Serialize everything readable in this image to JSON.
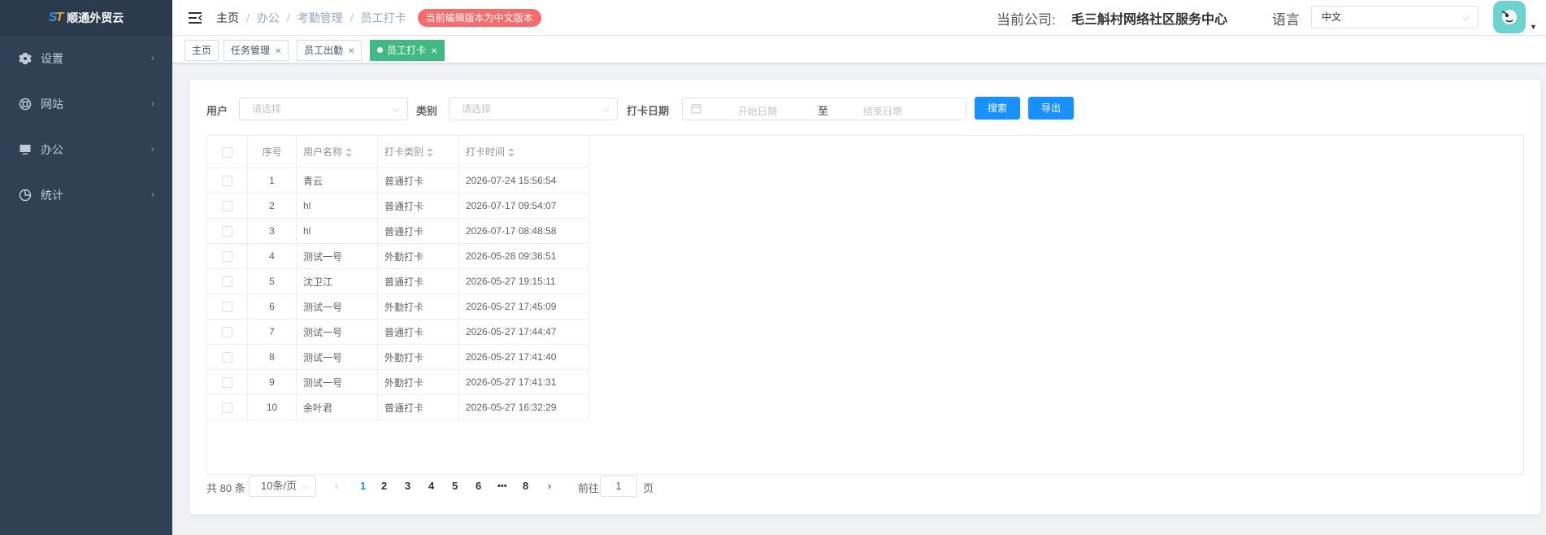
{
  "app": {
    "name": "顺通外贸云"
  },
  "sidebar": {
    "items": [
      {
        "label": "设置",
        "icon": "gear-icon"
      },
      {
        "label": "网站",
        "icon": "lifebuoy-icon"
      },
      {
        "label": "办公",
        "icon": "monitor-icon"
      },
      {
        "label": "统计",
        "icon": "pie-chart-icon"
      }
    ]
  },
  "navbar": {
    "breadcrumb": [
      "主页",
      "办公",
      "考勤管理",
      "员工打卡"
    ],
    "edit_badge": "当前编辑版本为中文版本",
    "company_label": "当前公司:",
    "company_name": "毛三斛村网络社区服务中心",
    "language_label": "语言",
    "language_value": "中文"
  },
  "tags": [
    {
      "label": "主页",
      "closable": false,
      "active": false
    },
    {
      "label": "任务管理",
      "closable": true,
      "active": false
    },
    {
      "label": "员工出勤",
      "closable": true,
      "active": false
    },
    {
      "label": "员工打卡",
      "closable": true,
      "active": true
    }
  ],
  "filters": {
    "user_label": "用户",
    "user_placeholder": "请选择",
    "type_label": "类别",
    "type_placeholder": "请选择",
    "date_label": "打卡日期",
    "start_placeholder": "开始日期",
    "range_separator": "至",
    "end_placeholder": "结束日期",
    "search_button": "搜索",
    "export_button": "导出"
  },
  "table": {
    "columns": [
      "序号",
      "用户名称",
      "打卡类别",
      "打卡时间"
    ],
    "rows": [
      {
        "no": "1",
        "user": "青云",
        "type": "普通打卡",
        "time": "2026-07-24 15:56:54"
      },
      {
        "no": "2",
        "user": "hl",
        "type": "普通打卡",
        "time": "2026-07-17 09:54:07"
      },
      {
        "no": "3",
        "user": "hl",
        "type": "普通打卡",
        "time": "2026-07-17 08:48:58"
      },
      {
        "no": "4",
        "user": "测试一号",
        "type": "外勤打卡",
        "time": "2026-05-28 09:36:51"
      },
      {
        "no": "5",
        "user": "沈卫江",
        "type": "普通打卡",
        "time": "2026-05-27 19:15:11"
      },
      {
        "no": "6",
        "user": "测试一号",
        "type": "外勤打卡",
        "time": "2026-05-27 17:45:09"
      },
      {
        "no": "7",
        "user": "测试一号",
        "type": "普通打卡",
        "time": "2026-05-27 17:44:47"
      },
      {
        "no": "8",
        "user": "测试一号",
        "type": "外勤打卡",
        "time": "2026-05-27 17:41:40"
      },
      {
        "no": "9",
        "user": "测试一号",
        "type": "外勤打卡",
        "time": "2026-05-27 17:41:31"
      },
      {
        "no": "10",
        "user": "余叶君",
        "type": "普通打卡",
        "time": "2026-05-27 16:32:29"
      }
    ]
  },
  "pagination": {
    "total_text": "共 80 条",
    "page_size": "10条/页",
    "pages": [
      "1",
      "2",
      "3",
      "4",
      "5",
      "6",
      "•••",
      "8"
    ],
    "current": "1",
    "goto_label": "前往",
    "goto_value": "1",
    "goto_suffix": "页"
  },
  "colors": {
    "sidebar_bg": "#304156",
    "primary": "#1890ff",
    "active_tag": "#42b983",
    "badge": "#f56c6c",
    "avatar": "#6cd3d0"
  }
}
